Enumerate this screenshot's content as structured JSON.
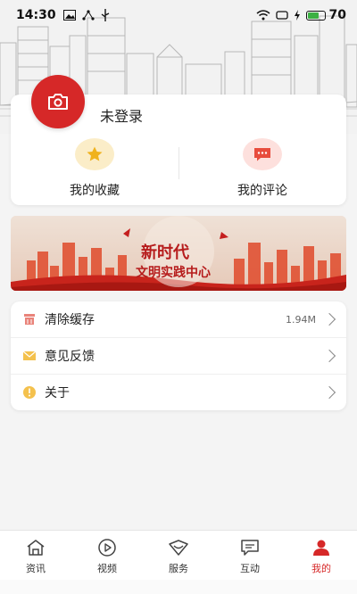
{
  "status_bar": {
    "time": "14:30",
    "battery_level": "70",
    "battery_fraction": 0.7
  },
  "profile": {
    "login_status": "未登录",
    "avatar_icon": "camera-icon",
    "quick_actions": [
      {
        "label": "我的收藏",
        "icon": "star-icon",
        "icon_bg": "#fbedc8",
        "icon_color": "#f0b21c"
      },
      {
        "label": "我的评论",
        "icon": "comment-icon",
        "icon_bg": "#fde0dd",
        "icon_color": "#e84c3d"
      }
    ]
  },
  "banner": {
    "title": "新时代",
    "subtitle": "文明实践中心"
  },
  "settings": [
    {
      "label": "清除缓存",
      "value": "1.94M",
      "icon": "broom-icon"
    },
    {
      "label": "意见反馈",
      "value": "",
      "icon": "envelope-icon"
    },
    {
      "label": "关于",
      "value": "",
      "icon": "info-icon"
    }
  ],
  "tabs": [
    {
      "label": "资讯",
      "icon": "home-icon",
      "active": false
    },
    {
      "label": "视频",
      "icon": "play-icon",
      "active": false
    },
    {
      "label": "服务",
      "icon": "heart-icon",
      "active": false
    },
    {
      "label": "互动",
      "icon": "chat-icon",
      "active": false
    },
    {
      "label": "我的",
      "icon": "user-icon",
      "active": true
    }
  ],
  "colors": {
    "accent": "#d62828",
    "banner_red": "#b61c1c"
  }
}
